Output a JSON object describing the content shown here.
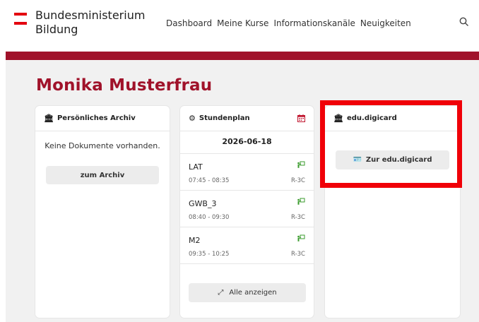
{
  "header": {
    "logo_line1": "Bundesministerium",
    "logo_line2": "Bildung",
    "nav": [
      "Dashboard",
      "Meine Kurse",
      "Informationskanäle",
      "Neuigkeiten"
    ]
  },
  "user": {
    "name": "Monika Musterfrau"
  },
  "archiv": {
    "title": "Persönliches Archiv",
    "empty_text": "Keine Dokumente vorhanden.",
    "button": "zum Archiv"
  },
  "stundenplan": {
    "title": "Stundenplan",
    "date": "2026-06-18",
    "lessons": [
      {
        "subject": "LAT",
        "time": "07:45 - 08:35",
        "room": "R-3C"
      },
      {
        "subject": "GWB_3",
        "time": "08:40 - 09:30",
        "room": "R-3C"
      },
      {
        "subject": "M2",
        "time": "09:35 - 10:25",
        "room": "R-3C"
      }
    ],
    "show_all": "Alle anzeigen"
  },
  "digicard": {
    "title": "edu.digicard",
    "button": "Zur edu.digicard"
  },
  "colors": {
    "brand": "#a0122a",
    "highlight": "#f00008",
    "tag": "#3a9b2c"
  }
}
